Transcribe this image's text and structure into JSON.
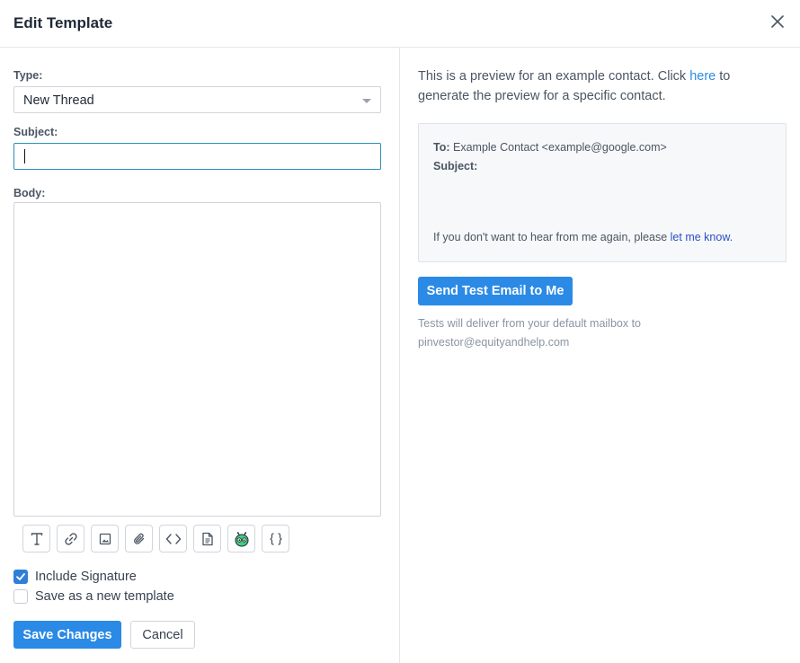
{
  "header": {
    "title": "Edit Template"
  },
  "form": {
    "type_label": "Type:",
    "type_value": "New Thread",
    "subject_label": "Subject:",
    "subject_value": "",
    "body_label": "Body:",
    "body_value": "",
    "toolbar": [
      {
        "name": "text-format-icon"
      },
      {
        "name": "link-icon"
      },
      {
        "name": "image-icon"
      },
      {
        "name": "attachment-icon"
      },
      {
        "name": "code-icon"
      },
      {
        "name": "document-icon"
      },
      {
        "name": "robot-icon"
      },
      {
        "name": "variables-icon"
      }
    ],
    "include_signature_label": "Include Signature",
    "include_signature_checked": true,
    "save_as_new_label": "Save as a new template",
    "save_as_new_checked": false,
    "save_button": "Save Changes",
    "cancel_button": "Cancel"
  },
  "preview": {
    "intro_before_link": "This is a preview for an example contact. Click ",
    "intro_link": "here",
    "intro_after_link": " to generate the preview for a specific contact.",
    "to_label": "To:",
    "to_value": " Example Contact <example@google.com>",
    "subject_label": "Subject:",
    "unsubscribe_text": "If you don't want to hear from me again, please ",
    "unsubscribe_link": "let me know.",
    "test_button": "Send Test Email to Me",
    "note_line1": "Tests will deliver from your default mailbox to",
    "note_line2": "pinvestor@equityandhelp.com"
  },
  "colors": {
    "primary": "#2a8ae6",
    "focus_border": "#2a8fb8",
    "checkbox": "#2f7fd8",
    "link_dark": "#2b4fc4"
  }
}
